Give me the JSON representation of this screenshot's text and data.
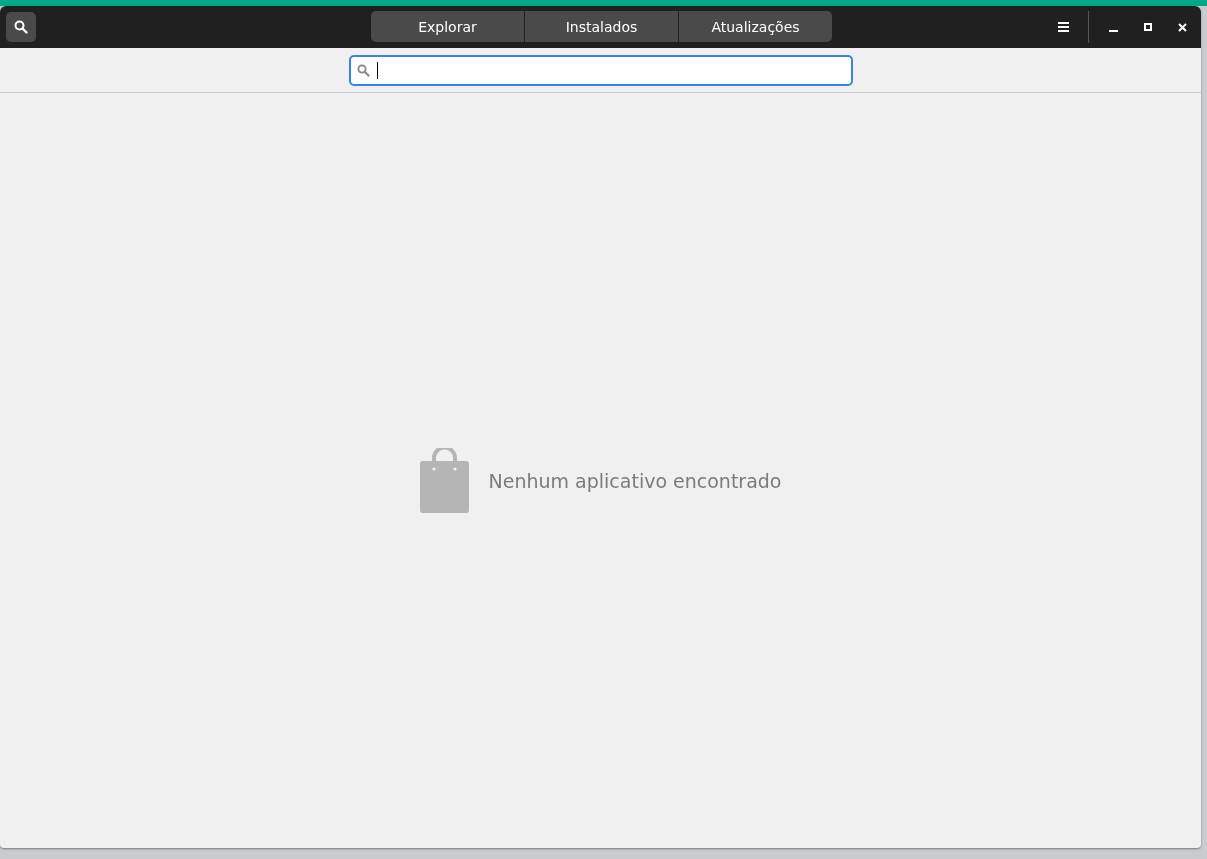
{
  "header": {
    "tabs": [
      {
        "label": "Explorar"
      },
      {
        "label": "Instalados"
      },
      {
        "label": "Atualizações"
      }
    ]
  },
  "empty_state": {
    "message": "Nenhum aplicativo encontrado"
  }
}
